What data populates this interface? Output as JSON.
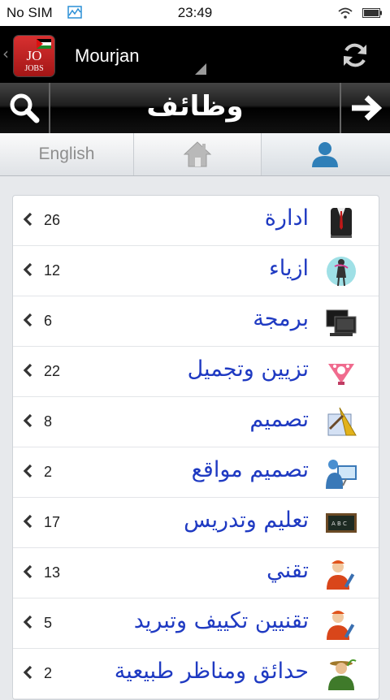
{
  "status_bar": {
    "carrier": "No SIM",
    "time": "23:49"
  },
  "app_bar": {
    "back_glyph": "‹",
    "logo": {
      "top": "JO",
      "bottom": "JOBS"
    },
    "app_name": "Mourjan"
  },
  "header": {
    "title": "وظائف"
  },
  "tabs": {
    "english_label": "English"
  },
  "categories": [
    {
      "label": "ادارة",
      "count": "26",
      "icon": "suit-icon"
    },
    {
      "label": "ازياء",
      "count": "12",
      "icon": "fashion-model-icon"
    },
    {
      "label": "برمجة",
      "count": "6",
      "icon": "computer-screens-icon"
    },
    {
      "label": "تزيين وتجميل",
      "count": "22",
      "icon": "beauty-icon"
    },
    {
      "label": "تصميم",
      "count": "8",
      "icon": "design-tools-icon"
    },
    {
      "label": "تصميم مواقع",
      "count": "2",
      "icon": "web-designer-icon"
    },
    {
      "label": "تعليم وتدريس",
      "count": "17",
      "icon": "blackboard-icon"
    },
    {
      "label": "تقني",
      "count": "13",
      "icon": "technician-icon"
    },
    {
      "label": "تقنيين تكييف وتبريد",
      "count": "5",
      "icon": "ac-technician-icon"
    },
    {
      "label": "حدائق ومناظر طبيعية",
      "count": "2",
      "icon": "gardener-icon"
    }
  ],
  "colors": {
    "category_text": "#1f3ac2",
    "user_tab_icon": "#2f7fb8",
    "logo_red": "#c82525"
  }
}
